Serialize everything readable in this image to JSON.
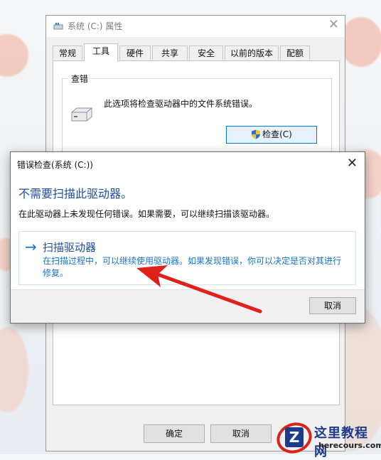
{
  "colors": {
    "accent": "#0078d7",
    "heading_blue": "#1f4fa0",
    "link_blue": "#1a73c8",
    "annotation_red": "#e0211b",
    "logo_blue": "#1c3b8c"
  },
  "properties_window": {
    "title": "系统 (C:) 属性",
    "title_icon": "drive-icon",
    "close_glyph": "✕",
    "tabs": [
      {
        "label": "常规",
        "active": false
      },
      {
        "label": "工具",
        "active": true
      },
      {
        "label": "硬件",
        "active": false
      },
      {
        "label": "共享",
        "active": false
      },
      {
        "label": "安全",
        "active": false
      },
      {
        "label": "以前的版本",
        "active": false
      },
      {
        "label": "配额",
        "active": false
      }
    ],
    "error_check_group": {
      "label": "查错",
      "description": "此选项将检查驱动器中的文件系统错误。",
      "check_button": "检查(C)",
      "check_button_icon": "shield-icon"
    },
    "ok_button": "确定",
    "cancel_button": "取消"
  },
  "dialog": {
    "title": "错误检查(系统 (C:))",
    "close_glyph": "✕",
    "heading": "不需要扫描此驱动器。",
    "message": "在此驱动器上未发现任何错误。如果需要，可以继续扫描该驱动器。",
    "scan_option": {
      "arrow": "→",
      "title": "扫描驱动器",
      "description": "在扫描过程中，可以继续使用驱动器。如果发现错误，你可以决定是否对其进行修复。"
    },
    "cancel_button": "取消"
  },
  "watermark": {
    "logo_letter": "Z",
    "name": "这里教程网",
    "url": "herecours.com"
  }
}
